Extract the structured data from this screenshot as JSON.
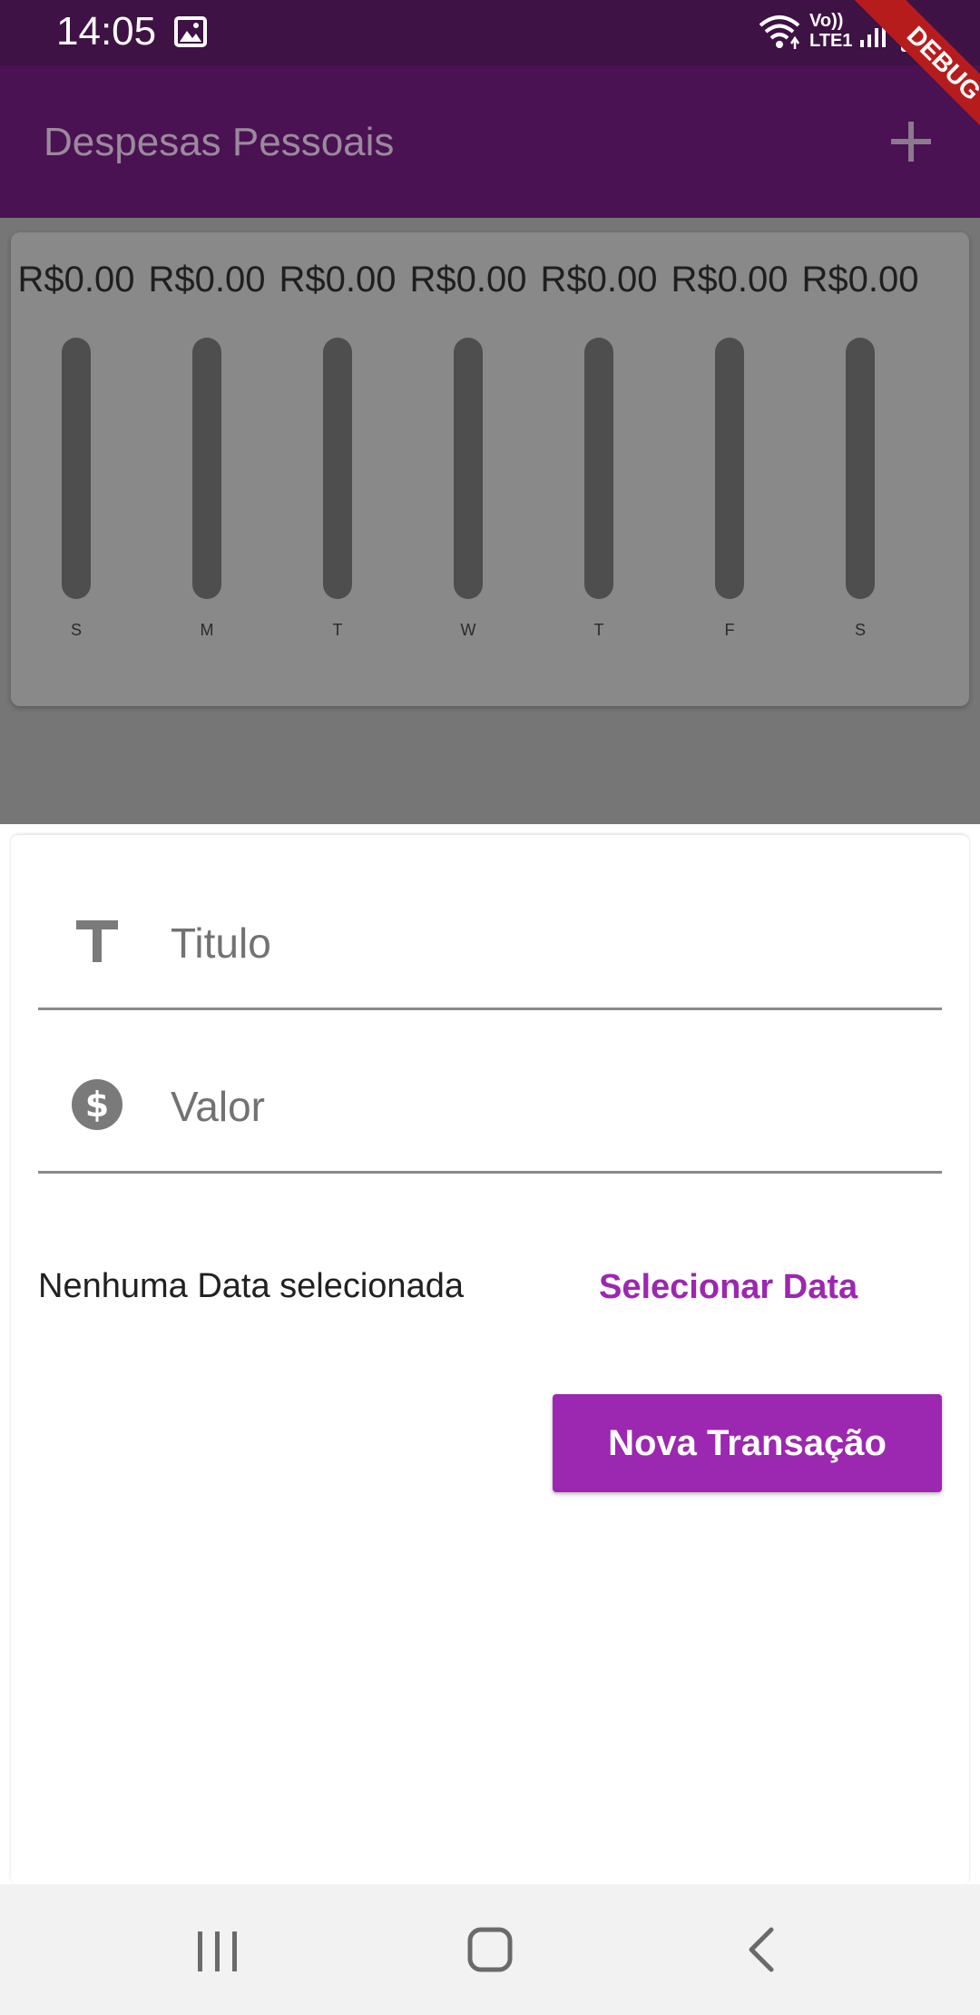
{
  "status_bar": {
    "time": "14:05",
    "network_label_top": "Vo))",
    "network_label_bottom": "LTE1",
    "icons": [
      "gallery-icon",
      "wifi-icon",
      "signal-icon",
      "battery-charging-icon"
    ]
  },
  "debug_banner": {
    "label": "DEBUG"
  },
  "app_bar": {
    "title": "Despesas Pessoais",
    "action_icon": "add-icon"
  },
  "chart_data": {
    "type": "bar",
    "categories": [
      "S",
      "M",
      "T",
      "W",
      "T",
      "F",
      "S"
    ],
    "values": [
      0,
      0,
      0,
      0,
      0,
      0,
      0
    ],
    "value_labels": [
      "R$0.00",
      "R$0.00",
      "R$0.00",
      "R$0.00",
      "R$0.00",
      "R$0.00",
      "R$0.00"
    ],
    "ylim": [
      0,
      1
    ],
    "title": "",
    "xlabel": "",
    "ylabel": "",
    "grid": false
  },
  "form": {
    "title_field": {
      "placeholder": "Titulo",
      "value": "",
      "icon": "title-icon"
    },
    "value_field": {
      "placeholder": "Valor",
      "value": "",
      "icon": "dollar-icon"
    },
    "date_status": "Nenhuma Data selecionada",
    "select_date_label": "Selecionar Data",
    "submit_label": "Nova Transação"
  },
  "nav_bar": {
    "buttons": [
      "recent-apps-icon",
      "home-icon",
      "back-icon"
    ]
  },
  "colors": {
    "primary": "#9c27b0",
    "app_bar_dimmed": "#4a1252",
    "status_bar": "#3e1244",
    "scrim": "#767676",
    "debug_banner": "#b71c1c"
  }
}
